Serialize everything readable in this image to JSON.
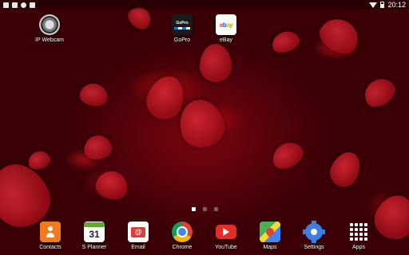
{
  "status_bar": {
    "time": "20:12",
    "left_icons": [
      "image-icon",
      "download-icon",
      "pinterest-icon",
      "notification-icon"
    ],
    "right_icons": [
      "wifi-icon",
      "battery-icon"
    ]
  },
  "desktop_shortcuts": [
    {
      "label": "IP Webcam",
      "icon": "ip-webcam-icon"
    },
    {
      "label": "GoPro",
      "icon": "gopro-icon",
      "icon_text": "GoPro"
    },
    {
      "label": "eBay",
      "icon": "ebay-icon"
    }
  ],
  "page_indicator": {
    "count": 3,
    "active_index": 0
  },
  "dock": [
    {
      "label": "Contacts",
      "icon": "contacts-icon"
    },
    {
      "label": "S Planner",
      "icon": "calendar-icon",
      "icon_text": "31"
    },
    {
      "label": "Email",
      "icon": "email-icon",
      "icon_text": "@"
    },
    {
      "label": "Chrome",
      "icon": "chrome-icon"
    },
    {
      "label": "YouTube",
      "icon": "youtube-icon"
    },
    {
      "label": "Maps",
      "icon": "maps-icon"
    },
    {
      "label": "Settings",
      "icon": "settings-icon"
    },
    {
      "label": "Apps",
      "icon": "apps-grid-icon"
    }
  ],
  "ebay_logo": {
    "e": "e",
    "b": "b",
    "a": "a",
    "y": "y"
  },
  "colors": {
    "wallpaper_base": "#3a0006",
    "petal": "#c81e2a",
    "contacts": "#f07a1e",
    "planner_header": "#5daa2e",
    "email": "#e23b36",
    "youtube": "#e52d27",
    "settings": "#3d7ee0"
  }
}
